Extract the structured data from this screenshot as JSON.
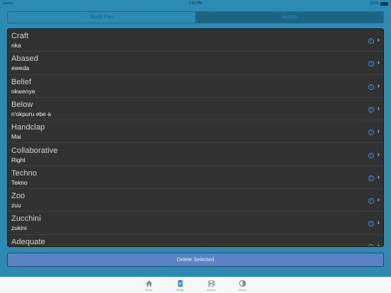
{
  "status_bar": {
    "carrier": "Carrier",
    "time": "2:03 PM",
    "battery": "100%"
  },
  "segments": [
    {
      "label": "Study Plan",
      "selected": false
    },
    {
      "label": "History",
      "selected": true
    }
  ],
  "words": [
    {
      "word": "Craft",
      "translation": "nka"
    },
    {
      "word": "Abased",
      "translation": "eweda"
    },
    {
      "word": "Belief",
      "translation": "nkwenye"
    },
    {
      "word": "Below",
      "translation": "n'okpuru ebe a"
    },
    {
      "word": "Handclap",
      "translation": "Mai"
    },
    {
      "word": "Collaborative",
      "translation": "Right"
    },
    {
      "word": "Techno",
      "translation": "Tekno"
    },
    {
      "word": "Zoo",
      "translation": "zuu"
    },
    {
      "word": "Zucchini",
      "translation": "zukini"
    },
    {
      "word": "Adequate",
      "translation": ""
    }
  ],
  "delete_label": "Delete Selected",
  "tabs": [
    {
      "label": "Home",
      "icon": "home-icon",
      "active": false
    },
    {
      "label": "Study",
      "icon": "clipboard-icon",
      "active": true
    },
    {
      "label": "Games",
      "icon": "film-icon",
      "active": false
    },
    {
      "label": "Others",
      "icon": "contrast-icon",
      "active": false
    }
  ],
  "colors": {
    "background": "#2b8bb1",
    "list_background": "#323232",
    "accent": "#2f7fe0",
    "delete_button": "#5b84c4"
  }
}
